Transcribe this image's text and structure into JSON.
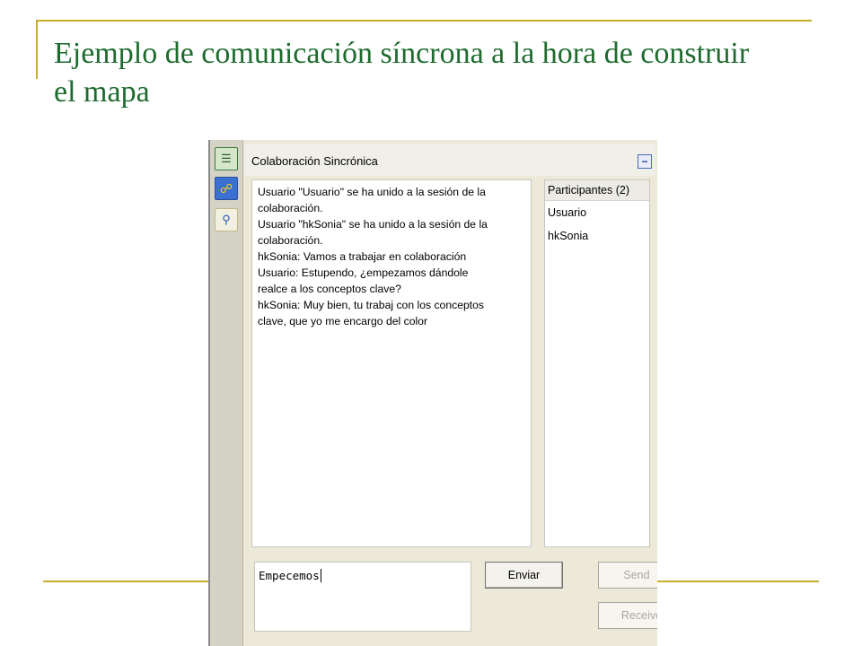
{
  "slide": {
    "title": "Ejemplo de comunicación síncrona a la hora de construir el mapa"
  },
  "colors": {
    "title_green": "#1e6b2e",
    "deco_gold": "#c9ae2c",
    "panel_bg": "#ece9d8"
  },
  "sidebar": {
    "icons": [
      "notes-icon",
      "collaboration-icon",
      "chat-icon"
    ]
  },
  "panel": {
    "title": "Colaboración Sincrónica",
    "minimize_symbol": "−"
  },
  "chat": {
    "lines": [
      "Usuario \"Usuario\" se ha unido a la sesión de la",
      "colaboración.",
      "Usuario \"hkSonia\" se ha unido a la sesión de la",
      "colaboración.",
      "hkSonia: Vamos a trabajar en colaboración",
      "Usuario: Estupendo, ¿empezamos dándole",
      "realce a los conceptos clave?",
      "hkSonia: Muy bien, tu trabaj con los conceptos",
      "clave, que yo me encargo del color"
    ]
  },
  "participants": {
    "header": "Participantes (2)",
    "items": [
      "Usuario",
      "hkSonia"
    ]
  },
  "message": {
    "value": "Empecemos"
  },
  "buttons": {
    "enviar": "Enviar",
    "send": "Send",
    "receive": "Receive"
  }
}
